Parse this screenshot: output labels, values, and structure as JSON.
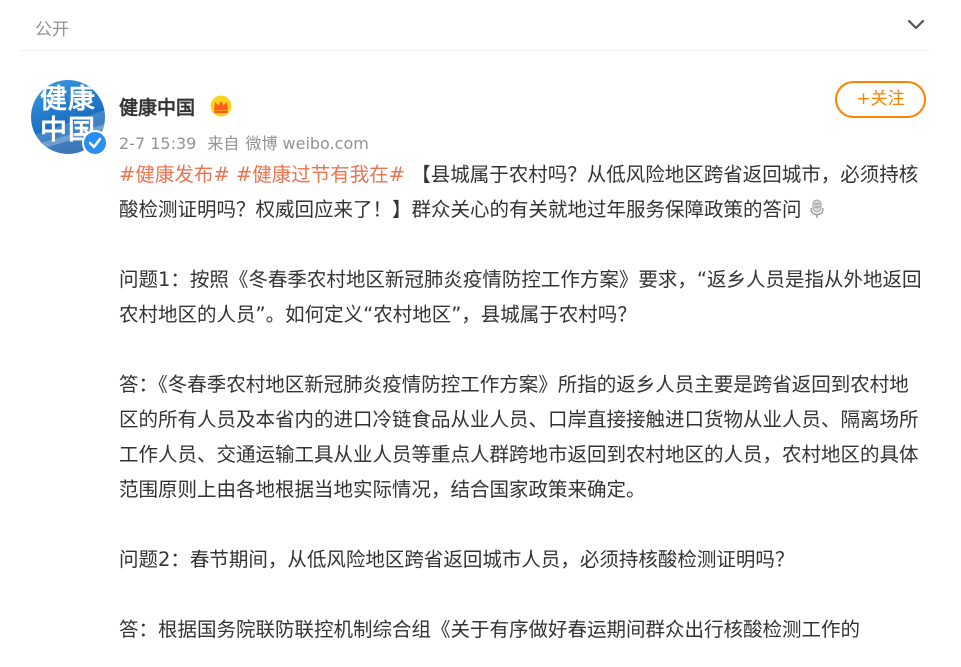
{
  "topbar": {
    "label": "公开"
  },
  "post": {
    "author": "健康中国",
    "avatar_text": "健康\n中国",
    "time": "2-7 15:39",
    "source_prefix": "来自",
    "source": "微博 weibo.com",
    "follow_label": "+关注",
    "tags": [
      "#健康发布#",
      "#健康过节有我在#"
    ],
    "headline": "【县城属于农村吗？从低风险地区跨省返回城市，必须持核酸检测证明吗？权威回应来了！】群众关心的有关就地过年服务保障政策的答问",
    "q1": "问题1：按照《冬春季农村地区新冠肺炎疫情防控工作方案》要求，“返乡人员是指从外地返回农村地区的人员”。如何定义“农村地区”，县城属于农村吗？",
    "a1": "答：《冬春季农村地区新冠肺炎疫情防控工作方案》所指的返乡人员主要是跨省返回到农村地区的所有人员及本省内的进口冷链食品从业人员、口岸直接接触进口货物从业人员、隔离场所工作人员、交通运输工具从业人员等重点人群跨地市返回到农村地区的人员，农村地区的具体范围原则上由各地根据当地实际情况，结合国家政策来确定。",
    "q2": "问题2：春节期间，从低风险地区跨省返回城市人员，必须持核酸检测证明吗？",
    "a2": "答：根据国务院联防联控机制综合组《关于有序做好春运期间群众出行核酸检测工作的"
  },
  "colors": {
    "accent": "#ff8200",
    "hashtag": "#eb7350",
    "meta": "#939393",
    "text": "#333333",
    "verified": "#2a8ef0"
  },
  "icons": {
    "collapse": "chevron-down-icon",
    "vip": "crown-icon",
    "verified": "check-icon",
    "mic": "microphone-icon"
  }
}
